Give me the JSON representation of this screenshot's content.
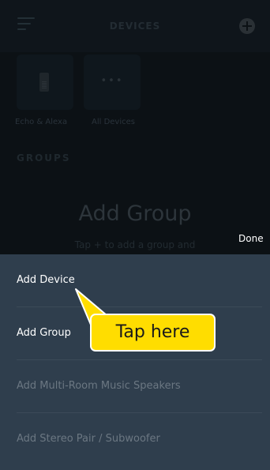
{
  "header": {
    "title": "DEVICES",
    "menu_icon": "hamburger-menu-icon",
    "add_icon": "plus-circle-icon"
  },
  "devices": {
    "tiles": [
      {
        "label": "Echo & Alexa",
        "icon": "echo-speaker-icon"
      },
      {
        "label": "All Devices",
        "icon": "ellipsis-icon",
        "glyph": "•••"
      }
    ]
  },
  "groups": {
    "heading": "GROUPS",
    "empty_title": "Add Group",
    "empty_hint": "Tap + to add a group and"
  },
  "done_label": "Done",
  "sheet": {
    "items": [
      {
        "label": "Add Device",
        "enabled": true
      },
      {
        "label": "Add Group",
        "enabled": true
      },
      {
        "label": "Add Multi-Room Music Speakers",
        "enabled": false
      },
      {
        "label": "Add Stereo Pair / Subwoofer",
        "enabled": false
      }
    ]
  },
  "callout": {
    "text": "Tap here"
  },
  "colors": {
    "sheet_bg": "#2f3e4d",
    "callout_bg": "#ffdd00",
    "background": "#0c1115"
  }
}
